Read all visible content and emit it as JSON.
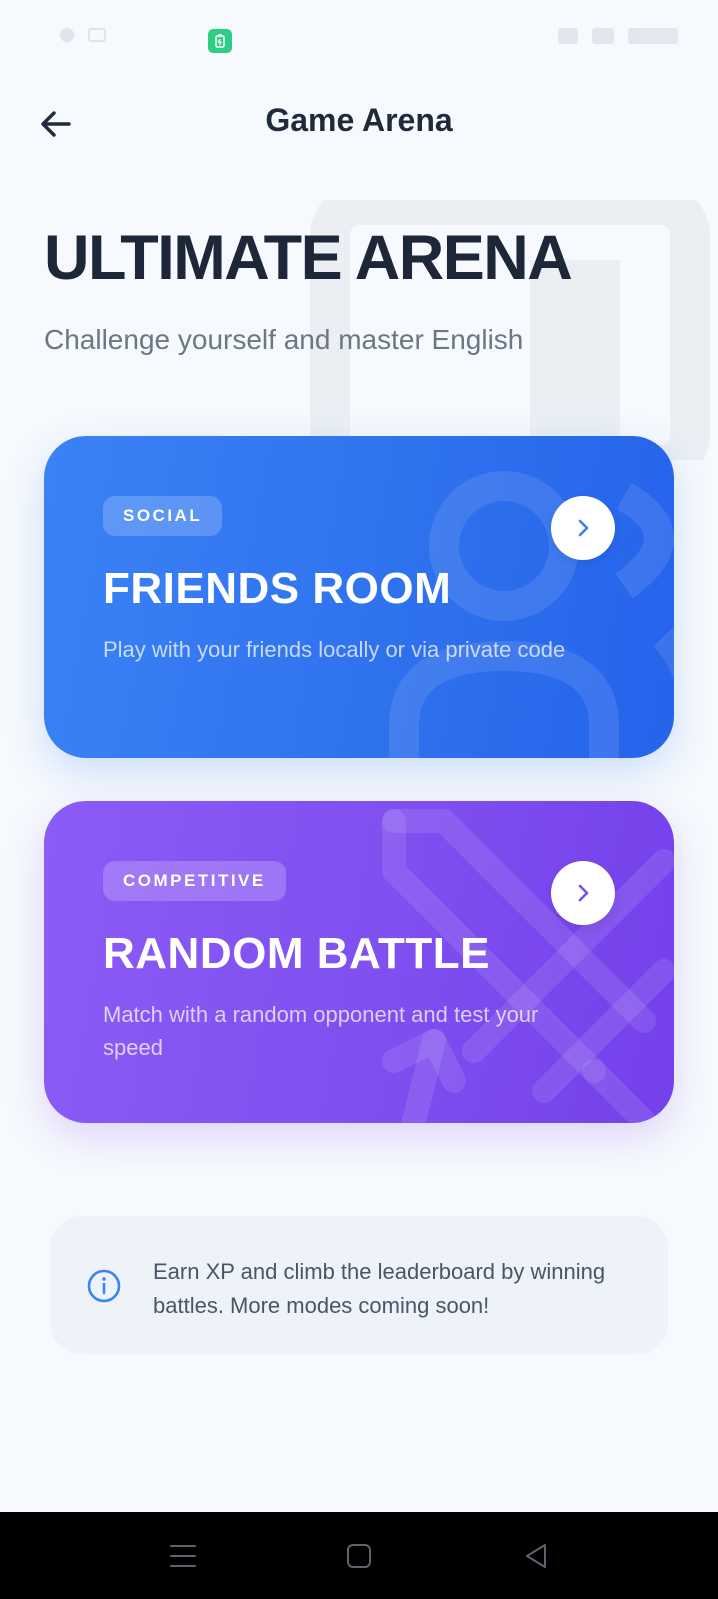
{
  "app": {
    "title": "Game Arena"
  },
  "hero": {
    "title": "ULTIMATE ARENA",
    "subtitle": "Challenge yourself and master English"
  },
  "modes": [
    {
      "tag": "SOCIAL",
      "title": "FRIENDS ROOM",
      "description": "Play with your friends locally or via private code",
      "color": "#3b82f6",
      "icon": "people-icon"
    },
    {
      "tag": "COMPETITIVE",
      "title": "RANDOM BATTLE",
      "description": "Match with a random opponent and test your speed",
      "color": "#8b5cf6",
      "icon": "swords-icon"
    }
  ],
  "info": {
    "text": "Earn XP and climb the leaderboard by winning battles. More modes coming soon!",
    "icon": "info-icon"
  },
  "colors": {
    "primary_blue": "#3b82f6",
    "primary_purple": "#8b5cf6",
    "battery": "#2ecf84",
    "background": "#f6f9fd"
  }
}
